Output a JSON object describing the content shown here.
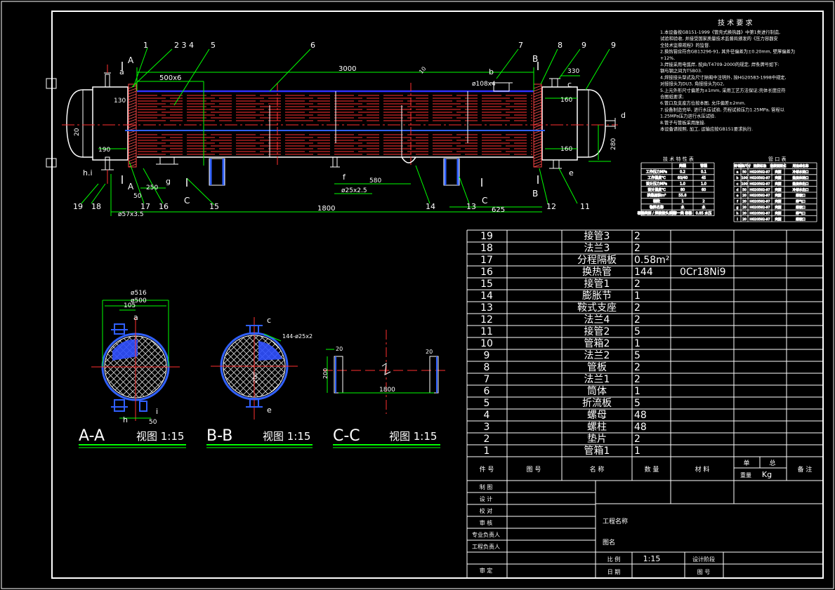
{
  "balloons": [
    "1",
    "2 3 4",
    "5",
    "6",
    "7",
    "8",
    "9",
    "9",
    "10",
    "11",
    "12",
    "13",
    "14",
    "15",
    "16",
    "17",
    "18",
    "19"
  ],
  "dims_main": {
    "d3000": "3000",
    "d500x6": "500x6",
    "d130": "130",
    "d190": "190",
    "d250": "250",
    "d20": "20",
    "d57": "ø57x3.5",
    "d50": "50",
    "d1800": "1800",
    "d580": "580",
    "d25": "ø25x2.5",
    "d625": "625",
    "d160a": "160",
    "d160b": "160",
    "d280": "280",
    "d330": "330",
    "d108": "ø108x4",
    "d10": "10",
    "nozzle_a": "a",
    "nozzle_b": "b",
    "nozzle_c": "c",
    "nozzle_d": "d",
    "nozzle_e": "e",
    "nozzle_f": "f",
    "nozzle_g": "g",
    "nozzle_hi": "h.i"
  },
  "sections": {
    "A": "A",
    "B": "B",
    "C": "C",
    "aa_title": "A-A",
    "bb_title": "B-B",
    "cc_title": "C-C",
    "view_label": "视图 1:15",
    "aa_516": "ø516",
    "aa_500": "ø500",
    "aa_105": "105",
    "aa_a": "a",
    "aa_h": "h",
    "aa_i": "i",
    "aa_50": "50",
    "bb_c": "c",
    "bb_e": "e",
    "bb_tubes": "144-ø25x2",
    "bb_200": "200",
    "cc_200": "200",
    "cc_1800": "1800",
    "cc_20a": "20",
    "cc_20b": "20"
  },
  "tech_req": {
    "title": "技 术 要 求",
    "lines": [
      "1.本设备按GB151-1999《管壳式换热器》中第1类进行制造,",
      "试验和验收, 并接受国家质量技术监督局颁发的《压力容器安",
      "全技术监察规程》的监督.",
      "2.换热管应符合GB13296-91, 其外径偏差为±0.20mm, 壁厚偏差为",
      "+12%.",
      "3.焊接采用电弧焊, 按JB/T4709-2000的规定, 焊条牌号如下:",
      "钢与钢之间为T5B03.",
      "4.焊接接头型式及尺寸除图中注明外, 按HG20583-1998中规定,",
      "对接接头为DU3, 角接接头为G2,",
      "5.上元外形尺寸偏差为±1mm, 采用工艺方法保证;壳体长度应符",
      "合图纸要求;",
      "6.管口及支座方位按本图, 允许偏差±2mm.",
      "7.设备制造完毕, 进行水压试验, 壳程试验压力1.25MPa, 管程以",
      "1.25MPa压力进行水压试验.",
      "8.管子与管板采用胀接.",
      "本设备请按照, 加工, 运输应按GB151要求执行."
    ]
  },
  "spec_table": {
    "title": "技 术 特 性 表",
    "header": [
      "",
      "壳程",
      "管程"
    ],
    "rows": [
      [
        "工作压力MPa",
        "0.2",
        "0.1"
      ],
      [
        "工作温度℃",
        "60/40",
        "45"
      ],
      [
        "设计压力MPa",
        "1.0",
        "1.0"
      ],
      [
        "设计温度℃",
        "80",
        "60"
      ],
      [
        "换热面积m²",
        "55.8",
        ""
      ],
      [
        "程数",
        "1",
        "2"
      ],
      [
        "物料名称",
        "水",
        "水"
      ],
      [
        "容器类别 / 焊接接头系数",
        "第一类 容器",
        "0.85 水压"
      ]
    ]
  },
  "nozzle_table": {
    "title": "管 口 表",
    "header": [
      "符号",
      "公称尺寸",
      "连接标准",
      "连接面型式",
      "用途或名称"
    ],
    "rows": [
      [
        "a",
        "50",
        "HG20592-97",
        "突面",
        "冷却水进口"
      ],
      [
        "b",
        "100",
        "HG20592-97",
        "突面",
        "热流体进口"
      ],
      [
        "c",
        "100",
        "HG20592-97",
        "突面",
        "热流体出口"
      ],
      [
        "d",
        "50",
        "HG20592-97",
        "突面",
        "冷却水出口"
      ],
      [
        "e",
        "20",
        "HG20592-97",
        "突面",
        "排液口"
      ],
      [
        "f",
        "20",
        "HG20592-97",
        "突面",
        "排气口"
      ],
      [
        "g",
        "20",
        "HG20592-97",
        "突面",
        "排液口"
      ],
      [
        "h",
        "20",
        "HG20592-97",
        "突面",
        "排气口"
      ],
      [
        "i",
        "20",
        "HG20592-97",
        "突面",
        "排液口"
      ]
    ]
  },
  "bom": {
    "rows": [
      {
        "no": "19",
        "name": "接管3",
        "qty": "2",
        "mat": ""
      },
      {
        "no": "18",
        "name": "法兰3",
        "qty": "2",
        "mat": ""
      },
      {
        "no": "17",
        "name": "分程隔板",
        "qty": "0.58m²",
        "mat": ""
      },
      {
        "no": "16",
        "name": "换热管",
        "qty": "144",
        "mat": "0Cr18Ni9"
      },
      {
        "no": "15",
        "name": "接管1",
        "qty": "2",
        "mat": ""
      },
      {
        "no": "14",
        "name": "膨胀节",
        "qty": "1",
        "mat": ""
      },
      {
        "no": "13",
        "name": "鞍式支座",
        "qty": "2",
        "mat": ""
      },
      {
        "no": "12",
        "name": "法兰4",
        "qty": "2",
        "mat": ""
      },
      {
        "no": "11",
        "name": "接管2",
        "qty": "5",
        "mat": ""
      },
      {
        "no": "10",
        "name": "管箱2",
        "qty": "1",
        "mat": ""
      },
      {
        "no": "9",
        "name": "法兰2",
        "qty": "5",
        "mat": ""
      },
      {
        "no": "8",
        "name": "管板",
        "qty": "2",
        "mat": ""
      },
      {
        "no": "7",
        "name": "法兰1",
        "qty": "2",
        "mat": ""
      },
      {
        "no": "6",
        "name": "筒体",
        "qty": "1",
        "mat": ""
      },
      {
        "no": "5",
        "name": "折流板",
        "qty": "5",
        "mat": ""
      },
      {
        "no": "4",
        "name": "螺母",
        "qty": "48",
        "mat": ""
      },
      {
        "no": "3",
        "name": "螺柱",
        "qty": "48",
        "mat": ""
      },
      {
        "no": "2",
        "name": "垫片",
        "qty": "2",
        "mat": ""
      },
      {
        "no": "1",
        "name": "管箱1",
        "qty": "1",
        "mat": ""
      }
    ],
    "header": {
      "no": "件  号",
      "code": "图  号",
      "name": "名  称",
      "qty": "数  量",
      "mat": "材  料",
      "unit": "单",
      "total": "总",
      "weight": "重量",
      "kg": "Kg",
      "note": "备  注"
    }
  },
  "title_block": {
    "left_labels": [
      "制  图",
      "设  计",
      "校  对",
      "审  核",
      "专业负责人",
      "工程负责人",
      "审  定"
    ],
    "project": "工程名称",
    "drawing_name": "图名",
    "scale_label": "比  例",
    "scale": "1:15",
    "stage": "设计阶段",
    "date": "日  期",
    "drawing_no": "图  号"
  }
}
